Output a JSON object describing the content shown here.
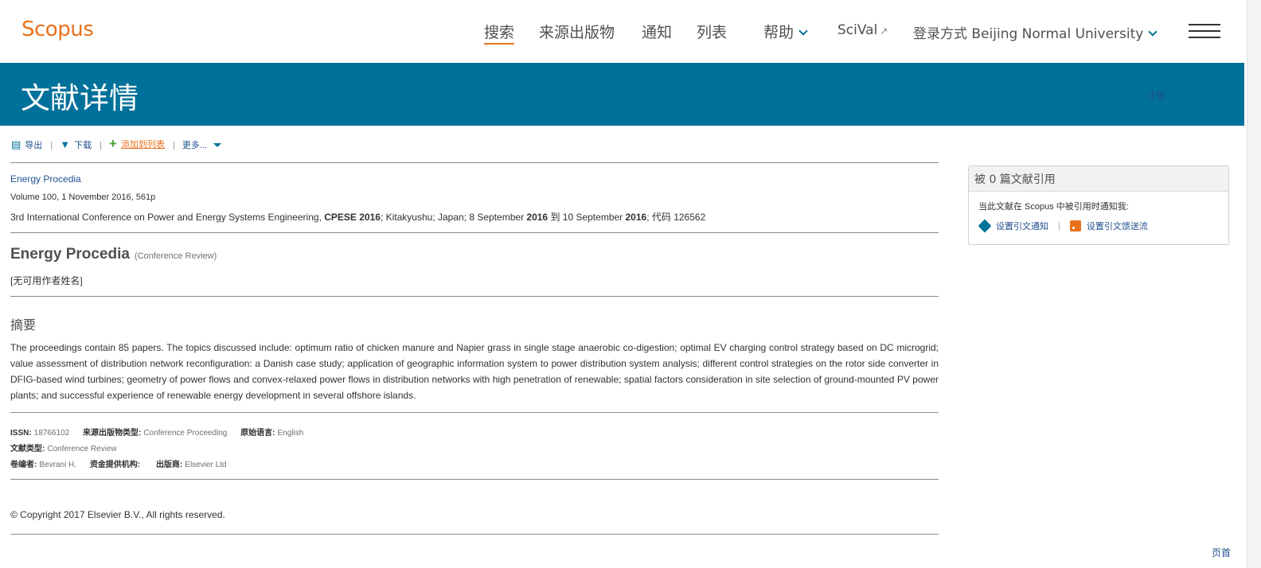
{
  "header": {
    "logo": "Scopus",
    "nav": [
      {
        "label": "搜索"
      },
      {
        "label": "来源出版物"
      },
      {
        "label": "通知"
      },
      {
        "label": "列表"
      },
      {
        "label": "帮助"
      },
      {
        "label": "SciVal",
        "ext": "↗"
      },
      {
        "label": "登录方式 Beijing Normal University"
      }
    ]
  },
  "banner": {
    "title": "文献详情",
    "right_link": "注销"
  },
  "toolbar": {
    "export": "导出",
    "download": "下载",
    "add_to_list": "添加到列表",
    "more": "更多..."
  },
  "source": {
    "journal": "Energy Procedia",
    "volume_line": "Volume 100, 1 November 2016, 561p",
    "conference_parts": [
      "3rd International Conference on Power and Energy Systems Engineering, ",
      "CPESE 2016",
      "; Kitakyushu; Japan; 8 September ",
      "2016",
      " 到 10 September ",
      "2016",
      "; 代码 126562"
    ]
  },
  "document": {
    "title": "Energy Procedia",
    "type": "(Conference Review)",
    "authors": "[无可用作者姓名]"
  },
  "abstract": {
    "heading": "摘要",
    "text": "The proceedings contain 85 papers. The topics discussed include: optimum ratio of chicken manure and Napier grass in single stage anaerobic co-digestion; optimal EV charging control strategy based on DC microgrid; value assessment of distribution network reconfiguration: a Danish case study; application of geographic information system to power distribution system analysis; different control strategies on the rotor side converter in DFIG-based wind turbines; geometry of power flows and convex-relaxed power flows in distribution networks with high penetration of renewable; spatial factors consideration in site selection of ground-mounted PV power plants; and successful experience of renewable energy development in several offshore islands."
  },
  "metadata": {
    "issn_label": "ISSN:",
    "issn": "18766102",
    "source_type_label": "来源出版物类型:",
    "source_type": "Conference Proceeding",
    "language_label": "原始语言:",
    "language": "English",
    "doc_type_label": "文献类型:",
    "doc_type": "Conference Review",
    "editors_label": "卷编者:",
    "editors": "Bevrani H.",
    "funding_label": "资金提供机构:",
    "funding": "",
    "publisher_label": "出版商:",
    "publisher": "Elsevier Ltd"
  },
  "copyright": "© Copyright 2017 Elsevier B.V., All rights reserved.",
  "panel": {
    "title": "被 0 篇文献引用",
    "notify_text": "当此文献在 Scopus 中被引用时通知我:",
    "set_alert": "设置引文通知",
    "set_feed": "设置引文馈送流"
  },
  "footer": {
    "top_link": "页首"
  }
}
